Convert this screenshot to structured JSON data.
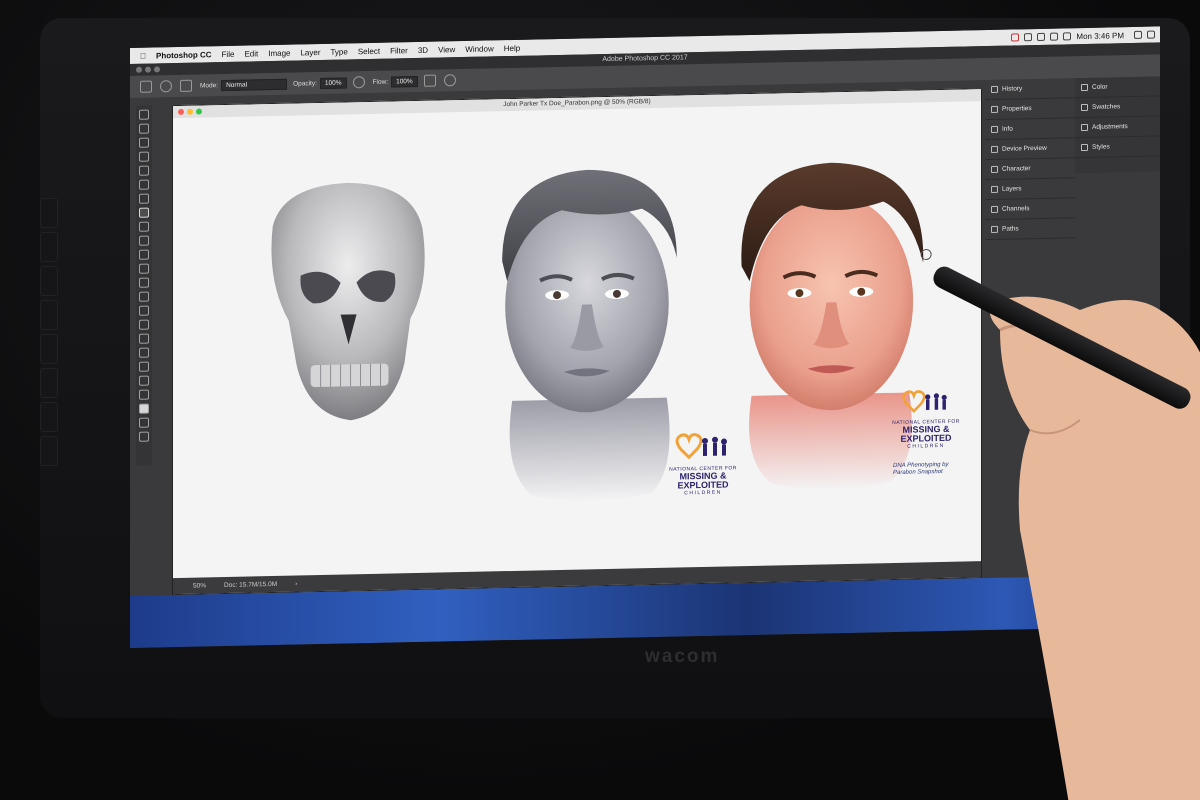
{
  "menubar": {
    "app": "Photoshop CC",
    "items": [
      "File",
      "Edit",
      "Image",
      "Layer",
      "Type",
      "Select",
      "Filter",
      "3D",
      "View",
      "Window",
      "Help"
    ],
    "clock": "Mon 3:46 PM"
  },
  "window": {
    "title": "Adobe Photoshop CC 2017"
  },
  "options": {
    "mode_label": "Mode:",
    "mode_value": "Normal",
    "opacity_label": "Opacity:",
    "opacity_value": "100%",
    "flow_label": "Flow:",
    "flow_value": "100%"
  },
  "document": {
    "title": "John Parker Tx Doe_Parabon.png @ 50% (RGB/8)",
    "zoom": "50%",
    "doc_size": "Doc: 15.7M/15.0M"
  },
  "panels": {
    "left": [
      "History",
      "Properties",
      "Info",
      "Device Preview",
      "Character",
      "Layers",
      "Channels",
      "Paths"
    ],
    "right": [
      "Color",
      "Swatches",
      "Adjustments",
      "Styles"
    ]
  },
  "logos": {
    "ncmec_top": "NATIONAL CENTER FOR",
    "ncmec_main1": "MISSING &",
    "ncmec_main2": "EXPLOITED",
    "ncmec_bottom": "CHILDREN",
    "parabon1": "DNA Phenotyping by",
    "parabon2": "Parabon Snapshot"
  },
  "device": {
    "brand": "wacom"
  },
  "colors": {
    "ncmec_orange": "#f2a23a",
    "ncmec_purple": "#2c2270",
    "wallpaper": "#2a54b0"
  }
}
